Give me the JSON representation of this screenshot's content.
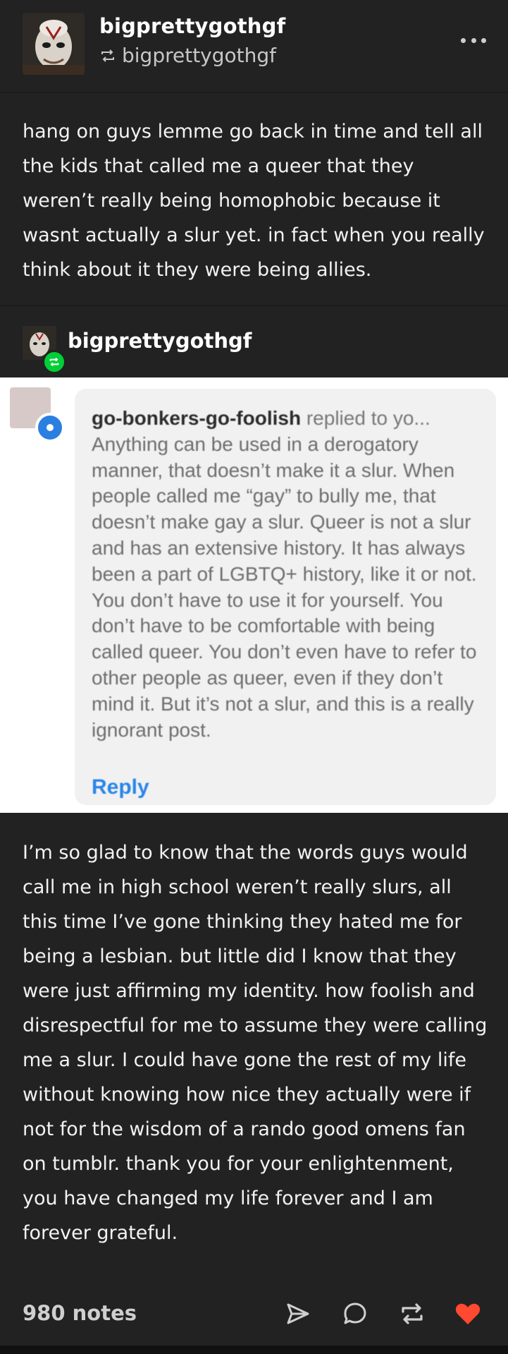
{
  "post": {
    "blog_name": "bigprettygothgf",
    "reblogged_from": "bigprettygothgf",
    "body_text": "hang on guys lemme go back in time and tell all the kids that called me a queer that they weren’t really being homophobic because it wasnt actually a slur yet. in fact when you really think about it they were being allies."
  },
  "trail": {
    "blog_name": "bigprettygothgf"
  },
  "screenshot": {
    "username": "go-bonkers-go-foolish",
    "action": "replied to yo...",
    "message": "Anything can be used in a derogatory manner, that doesn’t make it a slur. When people called me “gay” to bully me, that doesn’t make gay a slur. Queer is not a slur and has an extensive history. It has always been a part of LGBTQ+ history, like it or not. You don’t have to use it for yourself. You don’t have to be comfortable with being called queer. You don’t even have to refer to other people as queer, even if they don’t mind it. But it’s not a slur, and this is a really ignorant post.",
    "reply_label": "Reply",
    "reply_color": "#2a86e8"
  },
  "response": {
    "body_text": "I’m so glad to know that the words guys would call me in high school weren’t really slurs, all this time I’ve gone thinking they hated me for being a lesbian. but little did I know that they were just affirming my identity. how foolish and disrespectful for me to assume they were calling me a slur. I could have gone the rest of my life without knowing how nice they actually were if not for the wisdom of a rando good omens fan on tumblr. thank you for your enlightenment, you have changed my life forever and I am forever grateful."
  },
  "footer": {
    "notes": "980 notes",
    "icons": [
      "share-icon",
      "reply-icon",
      "reblog-icon",
      "like-heart-icon"
    ],
    "like_color": "#ff4930"
  },
  "colors": {
    "background": "#222222",
    "reblog_badge": "#00cf35"
  }
}
